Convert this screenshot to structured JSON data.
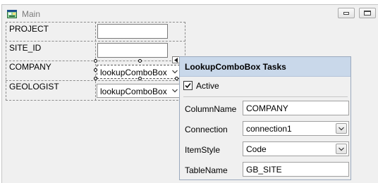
{
  "window": {
    "title": "Main"
  },
  "form": {
    "labels": [
      "PROJECT",
      "SITE_ID",
      "COMPANY",
      "GEOLOGIST"
    ],
    "company_combo_text": "lookupComboBox",
    "geologist_combo_text": "lookupComboBox"
  },
  "tasks_panel": {
    "title": "LookupComboBox Tasks",
    "active_label": "Active",
    "active_checked": true,
    "properties": [
      {
        "label": "ColumnName",
        "value": "COMPANY",
        "type": "text"
      },
      {
        "label": "Connection",
        "value": "connection1",
        "type": "dropdown"
      },
      {
        "label": "ItemStyle",
        "value": "Code",
        "type": "dropdown"
      },
      {
        "label": "TableName",
        "value": "GB_SITE",
        "type": "text"
      }
    ]
  },
  "icons": {
    "title": "app-window-icon",
    "minimize": "minimize-icon",
    "maximize": "maximize-icon",
    "smart_tag": "smart-tag-arrow-icon",
    "dropdown": "chevron-down-icon",
    "checkbox": "checkmark-icon"
  }
}
